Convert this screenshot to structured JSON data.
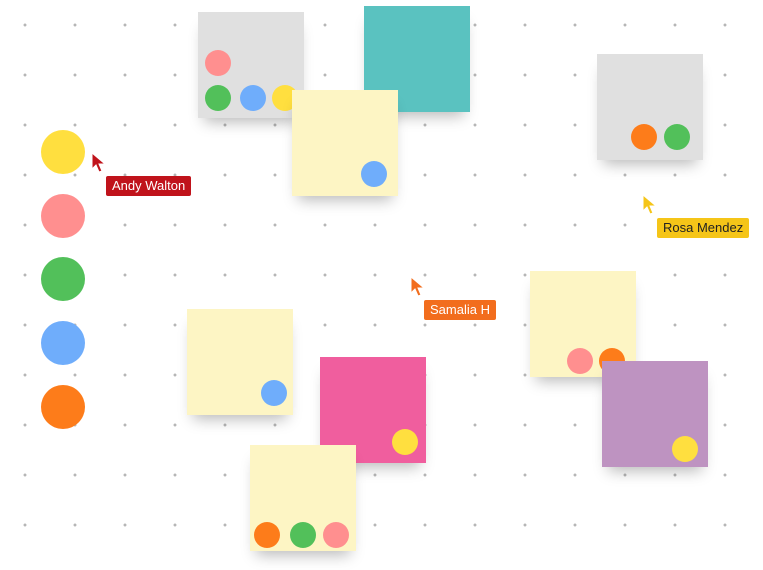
{
  "colors": {
    "yellow": "#ffdf3f",
    "pink": "#ff8f8f",
    "green": "#52c05a",
    "blue": "#6fadfb",
    "orange": "#fd7c1a",
    "note_gray": "#e0e0e0",
    "note_yellow": "#fdf5c4",
    "note_teal": "#5ac2c0",
    "note_magenta": "#f05e9e",
    "note_purple": "#be93c1"
  },
  "palette": [
    {
      "name": "yellow",
      "icon": "color-dot"
    },
    {
      "name": "pink",
      "icon": "color-dot"
    },
    {
      "name": "green",
      "icon": "color-dot"
    },
    {
      "name": "blue",
      "icon": "color-dot"
    },
    {
      "name": "orange",
      "icon": "color-dot"
    }
  ],
  "notes": [
    {
      "color": "note_gray",
      "dots": [
        "pink",
        "green",
        "blue",
        "yellow"
      ]
    },
    {
      "color": "note_teal",
      "dots": []
    },
    {
      "color": "note_yellow",
      "dots": [
        "blue"
      ]
    },
    {
      "color": "note_gray",
      "dots": [
        "orange",
        "green"
      ]
    },
    {
      "color": "note_yellow",
      "dots": [
        "pink",
        "orange"
      ]
    },
    {
      "color": "note_yellow",
      "dots": [
        "blue"
      ]
    },
    {
      "color": "note_magenta",
      "dots": [
        "yellow"
      ]
    },
    {
      "color": "note_purple",
      "dots": [
        "yellow"
      ]
    },
    {
      "color": "note_yellow",
      "dots": [
        "orange",
        "green",
        "pink"
      ]
    }
  ],
  "collaborators": [
    {
      "name": "Andy Walton",
      "cursor_color": "#c0131b",
      "label_color": "#c0131b",
      "text_color": "#ffffff",
      "icon": "cursor-arrow"
    },
    {
      "name": "Rosa Mendez",
      "cursor_color": "#f5c518",
      "label_color": "#f5c518",
      "text_color": "#222222",
      "icon": "cursor-arrow"
    },
    {
      "name": "Samalia H",
      "cursor_color": "#f26d1d",
      "label_color": "#f26d1d",
      "text_color": "#ffffff",
      "icon": "cursor-arrow"
    }
  ]
}
